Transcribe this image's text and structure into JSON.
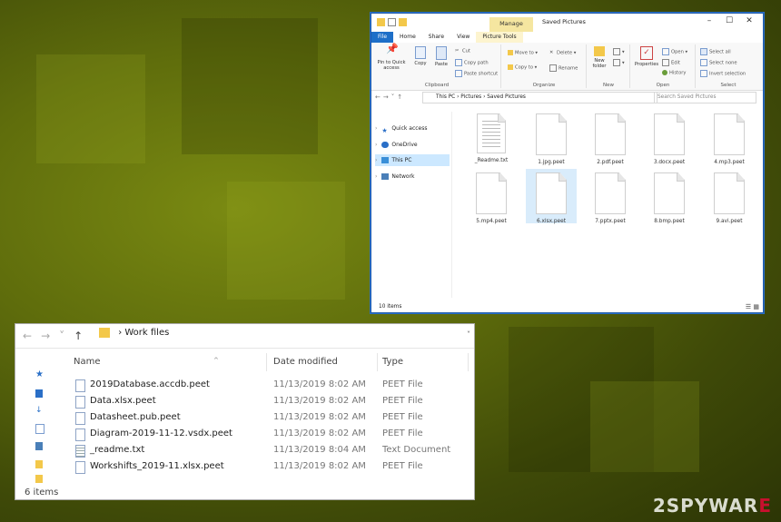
{
  "explorer": {
    "title": "Saved Pictures",
    "manage_label": "Manage",
    "tabs": [
      "File",
      "Home",
      "Share",
      "View",
      "Picture Tools"
    ],
    "ribbon": {
      "clipboard": {
        "group_label": "Clipboard",
        "pin_label": "Pin to Quick access",
        "copy_label": "Copy",
        "paste_label": "Paste",
        "cut_label": "Cut",
        "copy_path_label": "Copy path",
        "paste_shortcut_label": "Paste shortcut"
      },
      "organize": {
        "group_label": "Organize",
        "move_to_label": "Move to",
        "copy_to_label": "Copy to",
        "delete_label": "Delete",
        "rename_label": "Rename"
      },
      "new": {
        "group_label": "New",
        "new_folder_label": "New folder"
      },
      "open": {
        "group_label": "Open",
        "properties_label": "Properties",
        "open_label": "Open",
        "edit_label": "Edit",
        "history_label": "History"
      },
      "select": {
        "group_label": "Select",
        "select_all_label": "Select all",
        "select_none_label": "Select none",
        "invert_label": "Invert selection"
      }
    },
    "breadcrumb": [
      "This PC",
      "Pictures",
      "Saved Pictures"
    ],
    "search_placeholder": "Search Saved Pictures",
    "nav": [
      {
        "label": "Quick access"
      },
      {
        "label": "OneDrive"
      },
      {
        "label": "This PC"
      },
      {
        "label": "Network"
      }
    ],
    "files": [
      "_Readme.txt",
      "1.jpg.peet",
      "2.pdf.peet",
      "3.docx.peet",
      "4.mp3.peet",
      "5.mp4.peet",
      "6.xlsx.peet",
      "7.pptx.peet",
      "8.bmp.peet",
      "9.avi.peet"
    ],
    "status": "10 items"
  },
  "workfiles": {
    "path": "Work files",
    "columns": {
      "name": "Name",
      "date": "Date modified",
      "type": "Type"
    },
    "rows": [
      {
        "name": "2019Database.accdb.peet",
        "date": "11/13/2019 8:02 AM",
        "type": "PEET File"
      },
      {
        "name": "Data.xlsx.peet",
        "date": "11/13/2019 8:02 AM",
        "type": "PEET File"
      },
      {
        "name": "Datasheet.pub.peet",
        "date": "11/13/2019 8:02 AM",
        "type": "PEET File"
      },
      {
        "name": "Diagram-2019-11-12.vsdx.peet",
        "date": "11/13/2019 8:02 AM",
        "type": "PEET File"
      },
      {
        "name": "_readme.txt",
        "date": "11/13/2019 8:04 AM",
        "type": "Text Document"
      },
      {
        "name": "Workshifts_2019-11.xlsx.peet",
        "date": "11/13/2019 8:02 AM",
        "type": "PEET File"
      }
    ],
    "status": "6 items"
  },
  "watermark": {
    "prefix": "2SPYWAR",
    "suffix": "E"
  }
}
